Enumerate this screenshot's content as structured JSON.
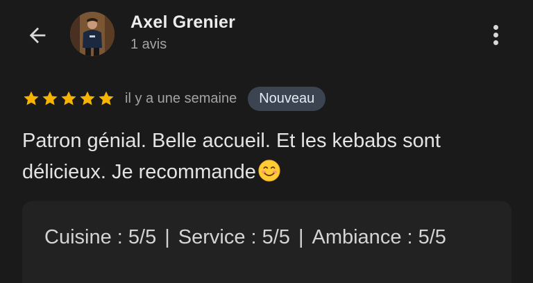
{
  "header": {
    "back_icon": "arrow-left-icon",
    "reviewer_name": "Axel Grenier",
    "review_count": "1 avis",
    "more_icon": "more-vert-icon"
  },
  "review": {
    "stars": 5,
    "star_color": "#f6b400",
    "time_ago": "il y a une semaine",
    "badge": "Nouveau",
    "text": "Patron génial. Belle accueil. Et les kebabs sont délicieux. Je recommande"
  },
  "scores": {
    "cuisine": "Cuisine : 5/5",
    "service": "Service : 5/5",
    "ambiance": "Ambiance : 5/5",
    "separator": "|"
  }
}
